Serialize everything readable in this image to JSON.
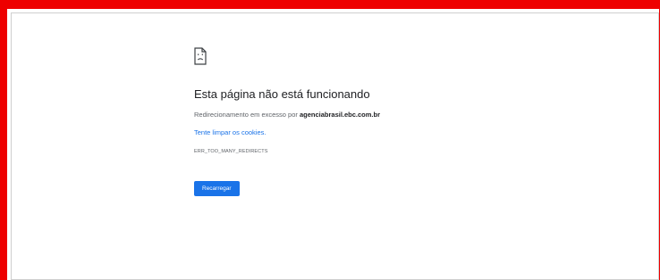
{
  "error_page": {
    "icon": "sad-page-icon",
    "title": "Esta página não está funcionando",
    "description_prefix": "Redirecionamento em excesso por ",
    "domain": "agenciabrasil.ebc.com.br",
    "suggestion_link": "Tente limpar os cookies.",
    "error_code": "ERR_TOO_MANY_REDIRECTS",
    "reload_button": "Recarregar"
  },
  "colors": {
    "frame": "#ee0000",
    "link": "#1a73e8",
    "button": "#1a73e8"
  }
}
